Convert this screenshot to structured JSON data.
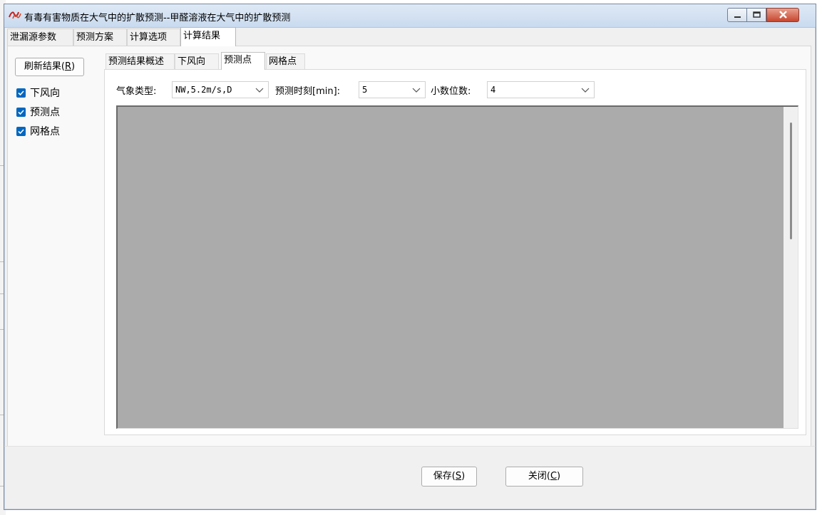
{
  "window": {
    "title": "有毒有害物质在大气中的扩散预测--甲醛溶液在大气中的扩散预测",
    "accent": "#0067c0"
  },
  "main_tabs": [
    {
      "label": "泄漏源参数",
      "active": false
    },
    {
      "label": "预测方案",
      "active": false
    },
    {
      "label": "计算选项",
      "active": false
    },
    {
      "label": "计算结果",
      "active": true
    }
  ],
  "left_panel": {
    "refresh_label": "刷新结果(",
    "refresh_key": "R",
    "refresh_tail": ")",
    "checkboxes": [
      {
        "label": "下风向",
        "checked": true
      },
      {
        "label": "预测点",
        "checked": true
      },
      {
        "label": "网格点",
        "checked": true
      }
    ]
  },
  "sub_tabs": [
    {
      "label": "预测结果概述",
      "active": false
    },
    {
      "label": "下风向",
      "active": false
    },
    {
      "label": "预测点",
      "active": true
    },
    {
      "label": "网格点",
      "active": false
    }
  ],
  "controls": {
    "weather_label": "气象类型:",
    "weather_value": "NW,5.2m/s,D",
    "time_label": "预测时刻[min]:",
    "time_value": "5",
    "decimals_label": "小数位数:",
    "decimals_value": "4"
  },
  "footer": {
    "save_label": "保存(",
    "save_key": "S",
    "close_label": "关闭(",
    "close_key": "C",
    "paren": ")"
  }
}
